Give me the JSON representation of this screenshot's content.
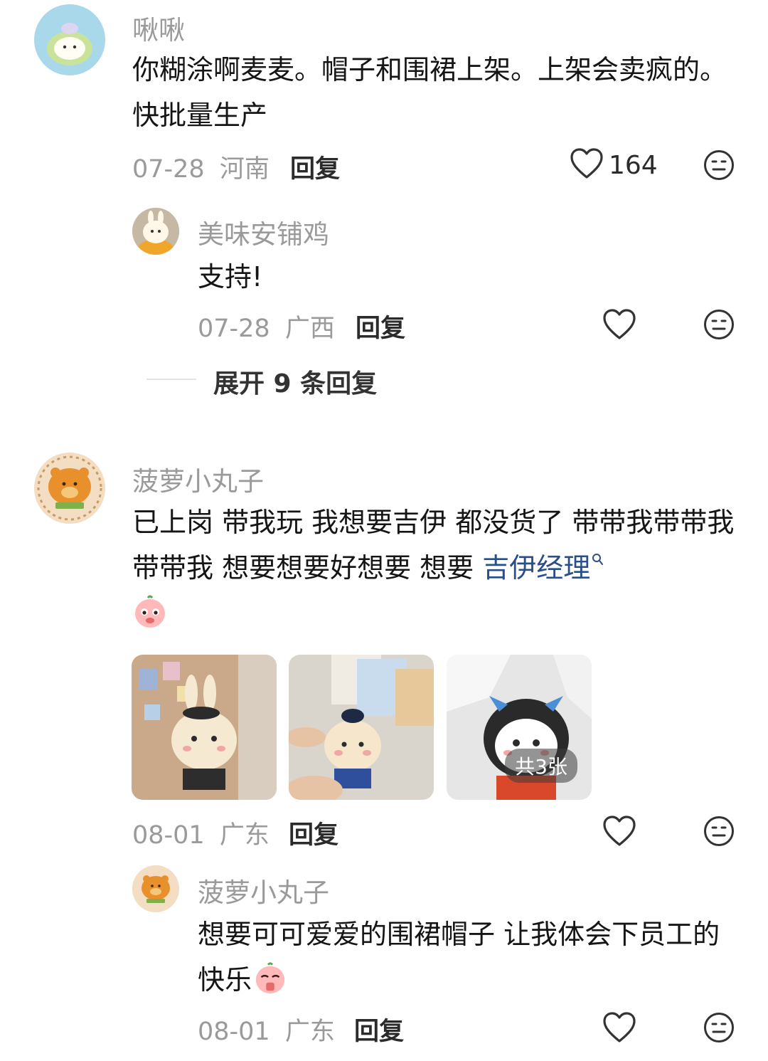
{
  "comments": [
    {
      "username": "啾啾",
      "text": "你糊涂啊麦麦。帽子和围裙上架。上架会卖疯的。快批量生产",
      "date": "07-28",
      "location": "河南",
      "reply_label": "回复",
      "likes": "164",
      "replies": [
        {
          "username": "美味安铺鸡",
          "text": "支持!",
          "date": "07-28",
          "location": "广西",
          "reply_label": "回复"
        }
      ],
      "expand_label": "展开 9 条回复"
    },
    {
      "username": "菠萝小丸子",
      "text_before_link": "已上岗 带我玩 我想要吉伊 都没货了 带带我带带我带带我 想要想要好想要 想要 ",
      "link_text": "吉伊经理",
      "images_badge": "共3张",
      "date": "08-01",
      "location": "广东",
      "reply_label": "回复",
      "replies": [
        {
          "username": "菠萝小丸子",
          "text": "想要可可爱爱的围裙帽子 让我体会下员工的快乐",
          "date": "08-01",
          "location": "广东",
          "reply_label": "回复"
        }
      ]
    }
  ],
  "icons": {
    "like": "heart-outline-icon",
    "dislike": "meh-face-icon",
    "search": "search-icon"
  },
  "colors": {
    "link": "#2a4f86",
    "meta": "#9a9a9a"
  }
}
